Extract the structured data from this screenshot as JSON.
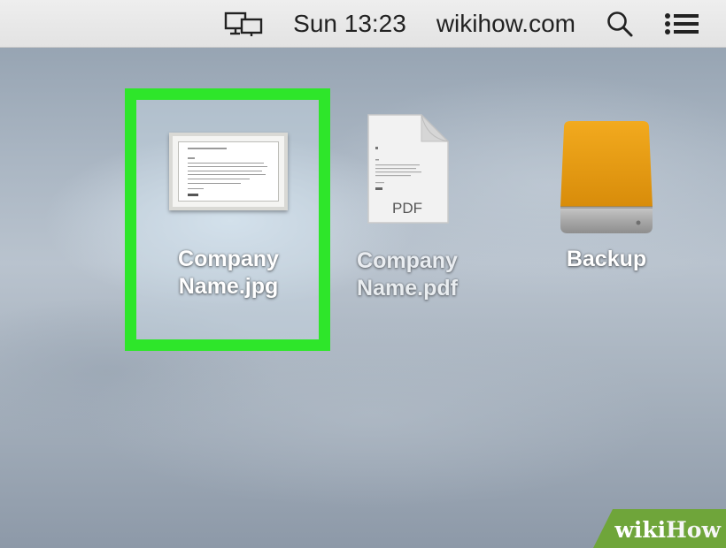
{
  "menubar": {
    "display_icon": "displays-icon",
    "clock": "Sun 13:23",
    "site": "wikihow.com",
    "search_icon": "search-icon",
    "list_icon": "notification-list-icon"
  },
  "desktop": {
    "items": [
      {
        "label": "Company\nName.jpg",
        "icon": "jpg-image-thumbnail-icon",
        "selected": true
      },
      {
        "label": "Company\nName.pdf",
        "icon": "pdf-document-icon",
        "badge": "PDF",
        "selected": false
      },
      {
        "label": "Backup",
        "icon": "external-drive-icon",
        "selected": false
      }
    ],
    "selection_color": "#2ee62a"
  },
  "watermark": {
    "part1": "wiki",
    "part2": "How",
    "bg_color": "#6fa53a"
  }
}
